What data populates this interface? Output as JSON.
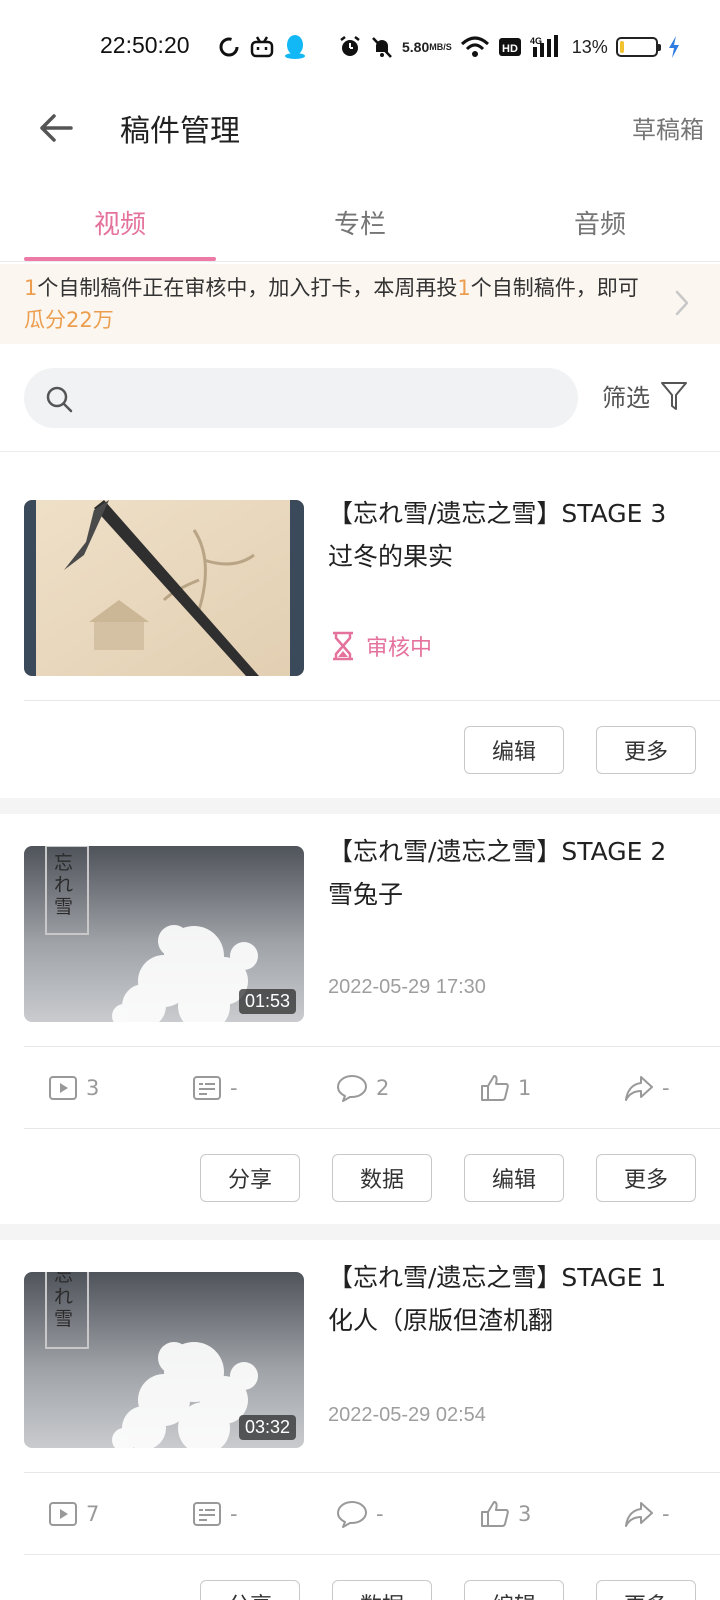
{
  "status_bar": {
    "time": "22:50:20",
    "net_speed_value": "5.80",
    "net_speed_unit": "MB/S",
    "signal_label": "4G",
    "battery_percent": "13%",
    "battery_level": 0.13,
    "icons": [
      "sync-icon",
      "bilibili-icon",
      "qq-icon",
      "alarm-icon",
      "mute-icon",
      "wifi-icon",
      "hd-icon",
      "signal-icon",
      "charging-icon"
    ]
  },
  "header": {
    "title": "稿件管理",
    "drafts_label": "草稿箱"
  },
  "tabs": [
    {
      "label": "视频",
      "active": true
    },
    {
      "label": "专栏",
      "active": false
    },
    {
      "label": "音频",
      "active": false
    }
  ],
  "notice": {
    "part1": "1",
    "part2": "个自制稿件正在审核中，加入打卡，本周再投",
    "part3": "1",
    "part4": "个自制稿件，即可",
    "part5": "瓜分22万"
  },
  "search": {
    "placeholder": "",
    "value": "",
    "filter_label": "筛选"
  },
  "videos": [
    {
      "title_line1": "【忘れ雪/遗忘之雪】STAGE 3",
      "title_line2": "过冬的果实",
      "status": "审核中",
      "buttons": {
        "edit": "编辑",
        "more": "更多"
      }
    },
    {
      "title_line1": "【忘れ雪/遗忘之雪】STAGE 2",
      "title_line2": "雪兔子",
      "duration": "01:53",
      "date": "2022-05-29 17:30",
      "thumb_text": "忘れ雪",
      "stats": {
        "plays": "3",
        "danmaku": "-",
        "comments": "2",
        "likes": "1",
        "shares": "-"
      },
      "buttons": {
        "share": "分享",
        "data": "数据",
        "edit": "编辑",
        "more": "更多"
      }
    },
    {
      "title_line1": "【忘れ雪/遗忘之雪】STAGE 1",
      "title_line2": "化人（原版但渣机翻",
      "duration": "03:32",
      "date": "2022-05-29 02:54",
      "thumb_text": "忘れ雪",
      "stats": {
        "plays": "7",
        "danmaku": "-",
        "comments": "-",
        "likes": "3",
        "shares": "-"
      },
      "buttons": {
        "share": "分享",
        "data": "数据",
        "edit": "编辑",
        "more": "更多"
      }
    }
  ],
  "colors": {
    "accent": "#e4729d",
    "highlight": "#ec9e4f",
    "notice_bg": "#fbf6f0"
  }
}
